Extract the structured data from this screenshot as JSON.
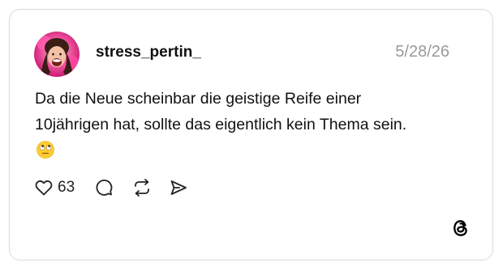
{
  "post": {
    "username": "stress_pertin_",
    "date": "5/28/26",
    "text": "Da die Neue scheinbar die geistige Reife einer 10jährigen hat, sollte das eigentlich kein Thema sein.",
    "emoji": "eye-roll-emoji",
    "likes": "63"
  },
  "icons": {
    "like": "heart-icon",
    "reply": "comment-icon",
    "repost": "repost-icon",
    "share": "send-icon",
    "brand": "threads-logo"
  },
  "colors": {
    "text": "#111111",
    "muted": "#9a9a9a",
    "border": "#dadada"
  }
}
